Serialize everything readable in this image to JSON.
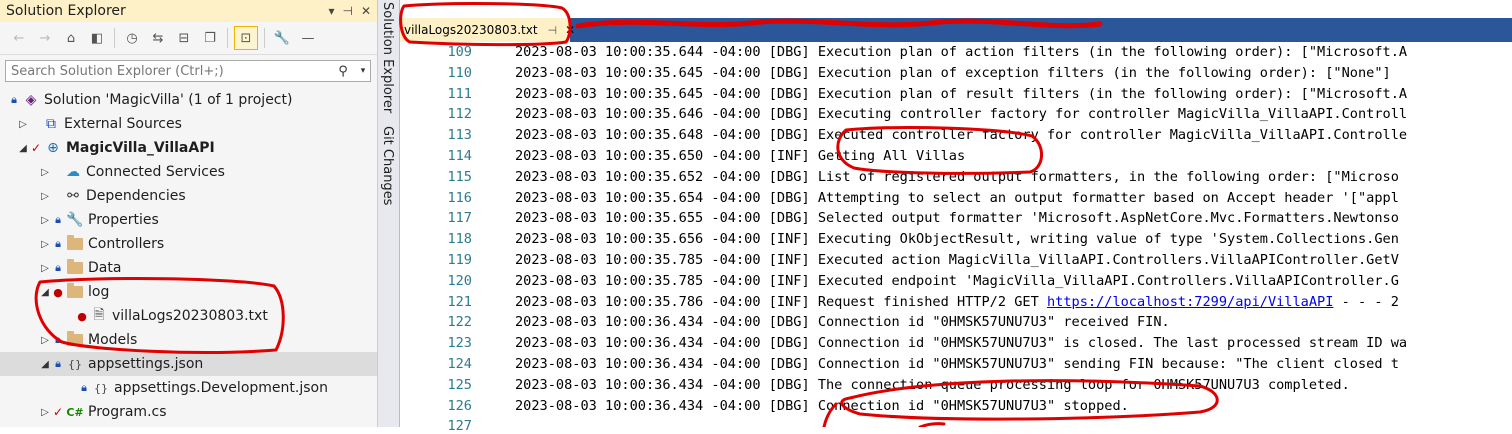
{
  "solution_explorer": {
    "title": "Solution Explorer",
    "title_buttons": [
      "▾",
      "⊣",
      "✕"
    ],
    "search_placeholder": "Search Solution Explorer (Ctrl+;)",
    "tree": [
      {
        "label": "Solution 'MagicVilla' (1 of 1 project)",
        "icon": "solution-icon"
      },
      {
        "label": "External Sources",
        "icon": "external-sources-icon"
      },
      {
        "label": "MagicVilla_VillaAPI",
        "icon": "web-project-icon"
      },
      {
        "label": "Connected Services",
        "icon": "connected-services-icon"
      },
      {
        "label": "Dependencies",
        "icon": "dependencies-icon"
      },
      {
        "label": "Properties",
        "icon": "wrench-icon"
      },
      {
        "label": "Controllers",
        "icon": "folder-icon"
      },
      {
        "label": "Data",
        "icon": "folder-icon"
      },
      {
        "label": "log",
        "icon": "folder-icon"
      },
      {
        "label": "villaLogs20230803.txt",
        "icon": "text-file-icon"
      },
      {
        "label": "Models",
        "icon": "folder-icon"
      },
      {
        "label": "appsettings.json",
        "icon": "json-file-icon"
      },
      {
        "label": "appsettings.Development.json",
        "icon": "json-file-icon"
      },
      {
        "label": "Program.cs",
        "icon": "csharp-file-icon"
      }
    ]
  },
  "side_tabs": [
    "Solution Explorer",
    "Git Changes"
  ],
  "editor": {
    "active_tab": "villaLogs20230803.txt",
    "lines": [
      {
        "n": "109",
        "text": "2023-08-03 10:00:35.644 -04:00 [DBG] Execution plan of action filters (in the following order): [\"Microsoft.A"
      },
      {
        "n": "110",
        "text": "2023-08-03 10:00:35.645 -04:00 [DBG] Execution plan of exception filters (in the following order): [\"None\"]"
      },
      {
        "n": "111",
        "text": "2023-08-03 10:00:35.645 -04:00 [DBG] Execution plan of result filters (in the following order): [\"Microsoft.A"
      },
      {
        "n": "112",
        "text": "2023-08-03 10:00:35.646 -04:00 [DBG] Executing controller factory for controller MagicVilla_VillaAPI.Controll"
      },
      {
        "n": "113",
        "text": "2023-08-03 10:00:35.648 -04:00 [DBG] Executed controller factory for controller MagicVilla_VillaAPI.Controlle"
      },
      {
        "n": "114",
        "text": "2023-08-03 10:00:35.650 -04:00 [INF] Getting All Villas"
      },
      {
        "n": "115",
        "text": "2023-08-03 10:00:35.652 -04:00 [DBG] List of registered output formatters, in the following order: [\"Microso"
      },
      {
        "n": "116",
        "text": "2023-08-03 10:00:35.654 -04:00 [DBG] Attempting to select an output formatter based on Accept header '[\"appl"
      },
      {
        "n": "117",
        "text": "2023-08-03 10:00:35.655 -04:00 [DBG] Selected output formatter 'Microsoft.AspNetCore.Mvc.Formatters.Newtonso"
      },
      {
        "n": "118",
        "text": "2023-08-03 10:00:35.656 -04:00 [INF] Executing OkObjectResult, writing value of type 'System.Collections.Gen"
      },
      {
        "n": "119",
        "text": "2023-08-03 10:00:35.785 -04:00 [INF] Executed action MagicVilla_VillaAPI.Controllers.VillaAPIController.GetV"
      },
      {
        "n": "120",
        "text": "2023-08-03 10:00:35.785 -04:00 [INF] Executed endpoint 'MagicVilla_VillaAPI.Controllers.VillaAPIController.G"
      },
      {
        "n": "121",
        "text": "2023-08-03 10:00:35.786 -04:00 [INF] Request finished HTTP/2 GET ",
        "link": "https://localhost:7299/api/VillaAPI",
        "after": " - - - 2"
      },
      {
        "n": "122",
        "text": "2023-08-03 10:00:36.434 -04:00 [DBG] Connection id \"0HMSK57UNU7U3\" received FIN."
      },
      {
        "n": "123",
        "text": "2023-08-03 10:00:36.434 -04:00 [DBG] Connection id \"0HMSK57UNU7U3\" is closed. The last processed stream ID wa"
      },
      {
        "n": "124",
        "text": "2023-08-03 10:00:36.434 -04:00 [DBG] Connection id \"0HMSK57UNU7U3\" sending FIN because: \"The client closed t"
      },
      {
        "n": "125",
        "text": "2023-08-03 10:00:36.434 -04:00 [DBG] The connection queue processing loop for 0HMSK57UNU7U3 completed."
      },
      {
        "n": "126",
        "text": "2023-08-03 10:00:36.434 -04:00 [DBG] Connection id \"0HMSK57UNU7U3\" stopped."
      },
      {
        "n": "127",
        "text": ""
      }
    ]
  },
  "colors": {
    "accent": "#2b579a",
    "active_tab": "#fff1c7",
    "annotation": "#e00000",
    "line_number": "#2b7c8f"
  }
}
